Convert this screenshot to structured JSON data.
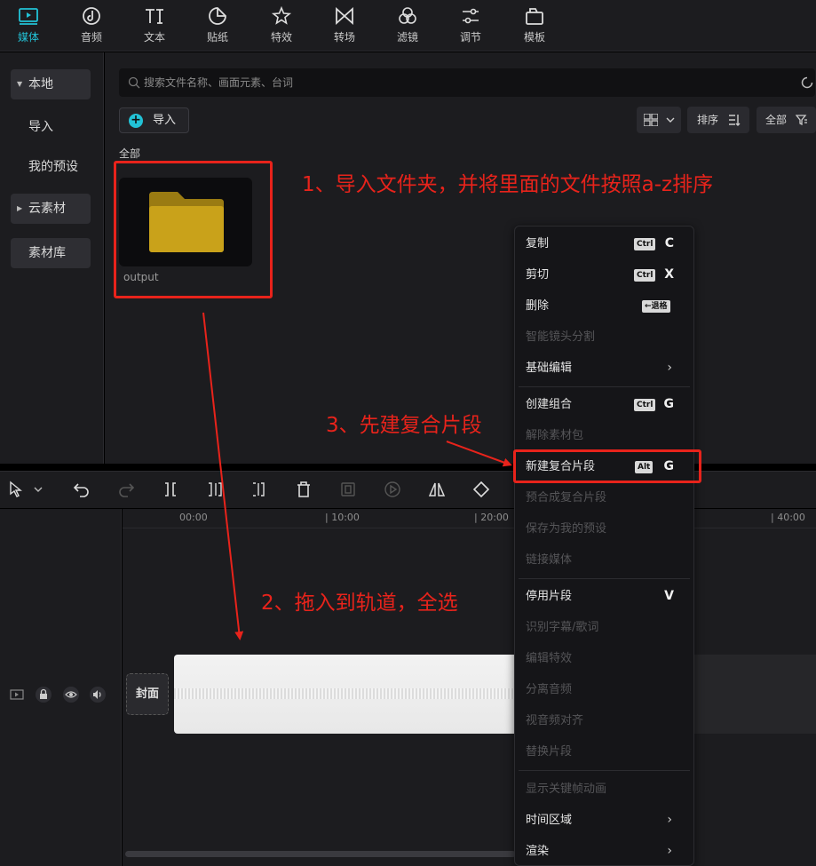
{
  "toolbar": {
    "tabs": [
      {
        "label": "媒体",
        "icon": "media-icon"
      },
      {
        "label": "音频",
        "icon": "audio-icon"
      },
      {
        "label": "文本",
        "icon": "text-icon"
      },
      {
        "label": "贴纸",
        "icon": "sticker-icon"
      },
      {
        "label": "特效",
        "icon": "effects-icon"
      },
      {
        "label": "转场",
        "icon": "transition-icon"
      },
      {
        "label": "滤镜",
        "icon": "filter-icon"
      },
      {
        "label": "调节",
        "icon": "adjust-icon"
      },
      {
        "label": "模板",
        "icon": "template-icon"
      }
    ],
    "active_color": "#22c2d6"
  },
  "sidebar": {
    "items": [
      "本地",
      "导入",
      "我的预设",
      "云素材",
      "素材库"
    ]
  },
  "media": {
    "search_placeholder": "搜索文件名称、画面元素、台词",
    "import_label": "导入",
    "sort_label": "排序",
    "filter_label": "全部",
    "section_label": "全部",
    "folder_name": "output",
    "folder_color": "#c9a21a"
  },
  "timeline": {
    "ticks": [
      "00:00",
      "| 10:00",
      "| 20:00",
      "| 40:00"
    ],
    "cover_label": "封面"
  },
  "context_menu": {
    "items": [
      {
        "label": "复制",
        "modifier": "Ctrl",
        "key": "C",
        "enabled": true
      },
      {
        "label": "剪切",
        "modifier": "Ctrl",
        "key": "X",
        "enabled": true
      },
      {
        "label": "删除",
        "modifier": "←退格",
        "key": "",
        "enabled": true
      },
      {
        "label": "智能镜头分割",
        "enabled": false
      },
      {
        "label": "基础编辑",
        "submenu": true,
        "enabled": true
      },
      {
        "label": "创建组合",
        "modifier": "Ctrl",
        "key": "G",
        "enabled": true
      },
      {
        "label": "解除素材包",
        "enabled": false
      },
      {
        "label": "新建复合片段",
        "modifier": "Alt",
        "key": "G",
        "enabled": true
      },
      {
        "label": "预合成复合片段",
        "enabled": false
      },
      {
        "label": "保存为我的预设",
        "enabled": false
      },
      {
        "label": "链接媒体",
        "enabled": false
      },
      {
        "label": "停用片段",
        "key": "V",
        "enabled": true
      },
      {
        "label": "识别字幕/歌词",
        "enabled": false
      },
      {
        "label": "编辑特效",
        "enabled": false
      },
      {
        "label": "分离音频",
        "enabled": false
      },
      {
        "label": "视音频对齐",
        "enabled": false
      },
      {
        "label": "替换片段",
        "enabled": false
      },
      {
        "label": "显示关键帧动画",
        "enabled": false
      },
      {
        "label": "时间区域",
        "submenu": true,
        "enabled": true
      },
      {
        "label": "渲染",
        "submenu": true,
        "enabled": true
      }
    ],
    "submenu_arrow": "›"
  },
  "annotations": {
    "step1": "1、导入文件夹，并将里面的文件按照a-z排序",
    "step2": "2、拖入到轨道，全选",
    "step3": "3、先建复合片段",
    "color": "#e8231b"
  }
}
